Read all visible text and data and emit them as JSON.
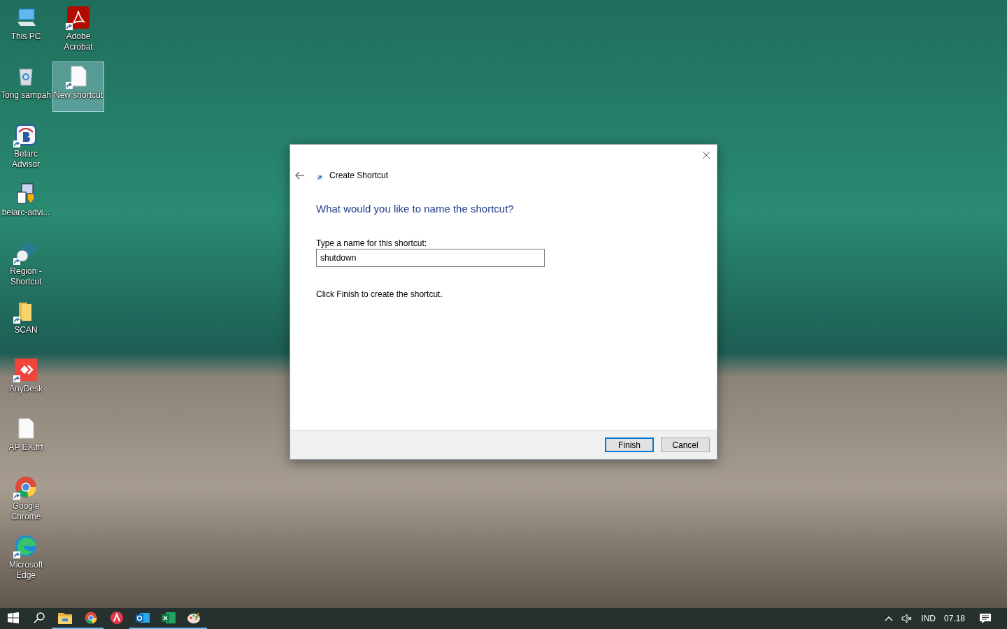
{
  "desktop": {
    "icons": [
      {
        "label": "This PC",
        "kind": "pc",
        "shortcut": false,
        "selected": false
      },
      {
        "label": "Tong sampah",
        "kind": "recycle",
        "shortcut": false,
        "selected": false
      },
      {
        "label": "Belarc Advisor",
        "kind": "belarc",
        "shortcut": true,
        "selected": false
      },
      {
        "label": "belarc-advi...",
        "kind": "installer",
        "shortcut": false,
        "selected": false
      },
      {
        "label": "Region - Shortcut",
        "kind": "globe",
        "shortcut": true,
        "selected": false
      },
      {
        "label": "SCAN",
        "kind": "folder",
        "shortcut": true,
        "selected": false
      },
      {
        "label": "AnyDesk",
        "kind": "anydesk",
        "shortcut": true,
        "selected": false
      },
      {
        "label": "AP EX.frf",
        "kind": "file",
        "shortcut": false,
        "selected": false
      },
      {
        "label": "Google Chrome",
        "kind": "chrome",
        "shortcut": true,
        "selected": false
      },
      {
        "label": "Microsoft Edge",
        "kind": "edge",
        "shortcut": true,
        "selected": false
      },
      {
        "label": "Adobe Acrobat",
        "kind": "pdf",
        "shortcut": true,
        "selected": false
      },
      {
        "label": "New shortcut",
        "kind": "file",
        "shortcut": true,
        "selected": true
      }
    ]
  },
  "dialog": {
    "title": "Create Shortcut",
    "heading": "What would you like to name the shortcut?",
    "field_label": "Type a name for this shortcut:",
    "field_value": "shutdown",
    "instruction": "Click Finish to create the shortcut.",
    "buttons": [
      {
        "label": "Finish",
        "default": true
      },
      {
        "label": "Cancel",
        "default": false
      }
    ]
  },
  "taskbar": {
    "apps": [
      {
        "kind": "explorer",
        "running": true
      },
      {
        "kind": "chrome",
        "running": true
      },
      {
        "kind": "redapp",
        "running": false
      },
      {
        "kind": "outlook",
        "running": true
      },
      {
        "kind": "excel",
        "running": true
      },
      {
        "kind": "paint",
        "running": true
      }
    ],
    "muted": true,
    "language": "IND",
    "clock": "07.18"
  }
}
